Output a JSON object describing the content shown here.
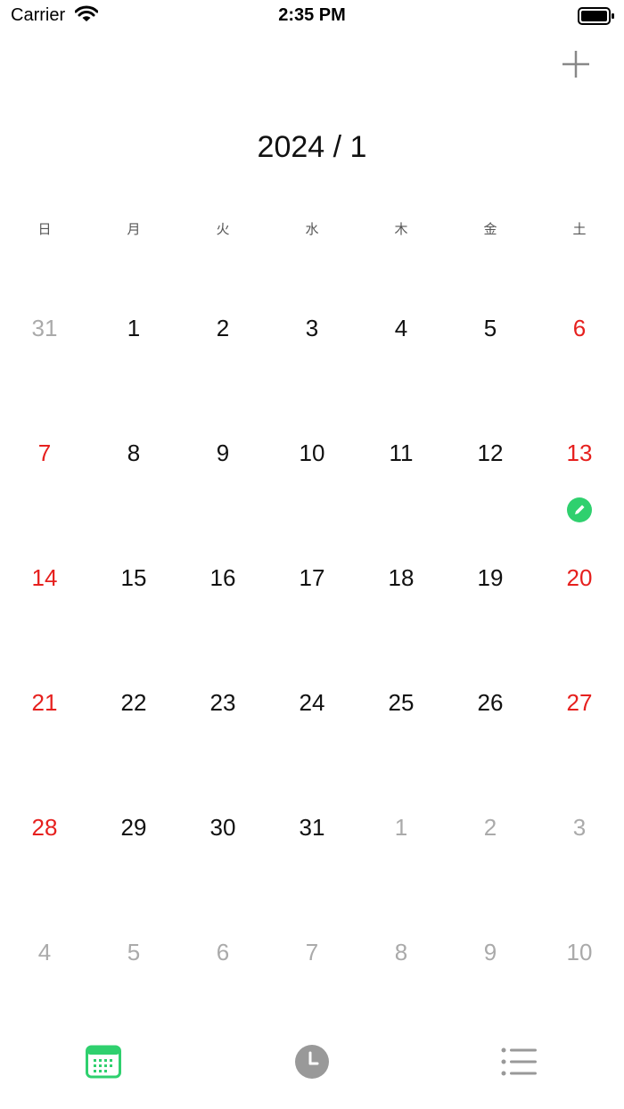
{
  "status_bar": {
    "carrier": "Carrier",
    "time": "2:35 PM"
  },
  "calendar": {
    "month_label": "2024 / 1",
    "weekdays": [
      "日",
      "月",
      "火",
      "水",
      "木",
      "金",
      "土"
    ],
    "weeks": [
      [
        {
          "label": "31",
          "outside": true,
          "weekend": false
        },
        {
          "label": "1",
          "outside": false,
          "weekend": false
        },
        {
          "label": "2",
          "outside": false,
          "weekend": false
        },
        {
          "label": "3",
          "outside": false,
          "weekend": false
        },
        {
          "label": "4",
          "outside": false,
          "weekend": false
        },
        {
          "label": "5",
          "outside": false,
          "weekend": false
        },
        {
          "label": "6",
          "outside": false,
          "weekend": true
        }
      ],
      [
        {
          "label": "7",
          "outside": false,
          "weekend": true
        },
        {
          "label": "8",
          "outside": false,
          "weekend": false
        },
        {
          "label": "9",
          "outside": false,
          "weekend": false
        },
        {
          "label": "10",
          "outside": false,
          "weekend": false
        },
        {
          "label": "11",
          "outside": false,
          "weekend": false
        },
        {
          "label": "12",
          "outside": false,
          "weekend": false
        },
        {
          "label": "13",
          "outside": false,
          "weekend": true,
          "has_event": true
        }
      ],
      [
        {
          "label": "14",
          "outside": false,
          "weekend": true
        },
        {
          "label": "15",
          "outside": false,
          "weekend": false
        },
        {
          "label": "16",
          "outside": false,
          "weekend": false
        },
        {
          "label": "17",
          "outside": false,
          "weekend": false
        },
        {
          "label": "18",
          "outside": false,
          "weekend": false
        },
        {
          "label": "19",
          "outside": false,
          "weekend": false
        },
        {
          "label": "20",
          "outside": false,
          "weekend": true
        }
      ],
      [
        {
          "label": "21",
          "outside": false,
          "weekend": true
        },
        {
          "label": "22",
          "outside": false,
          "weekend": false
        },
        {
          "label": "23",
          "outside": false,
          "weekend": false
        },
        {
          "label": "24",
          "outside": false,
          "weekend": false
        },
        {
          "label": "25",
          "outside": false,
          "weekend": false
        },
        {
          "label": "26",
          "outside": false,
          "weekend": false
        },
        {
          "label": "27",
          "outside": false,
          "weekend": true
        }
      ],
      [
        {
          "label": "28",
          "outside": false,
          "weekend": true
        },
        {
          "label": "29",
          "outside": false,
          "weekend": false
        },
        {
          "label": "30",
          "outside": false,
          "weekend": false
        },
        {
          "label": "31",
          "outside": false,
          "weekend": false
        },
        {
          "label": "1",
          "outside": true,
          "weekend": false
        },
        {
          "label": "2",
          "outside": true,
          "weekend": false
        },
        {
          "label": "3",
          "outside": true,
          "weekend": false
        }
      ],
      [
        {
          "label": "4",
          "outside": true,
          "weekend": false
        },
        {
          "label": "5",
          "outside": true,
          "weekend": false
        },
        {
          "label": "6",
          "outside": true,
          "weekend": false
        },
        {
          "label": "7",
          "outside": true,
          "weekend": false
        },
        {
          "label": "8",
          "outside": true,
          "weekend": false
        },
        {
          "label": "9",
          "outside": true,
          "weekend": false
        },
        {
          "label": "10",
          "outside": true,
          "weekend": false
        }
      ]
    ],
    "event_icon": "pencil-icon"
  },
  "tab_bar": {
    "tabs": [
      {
        "icon": "calendar-icon",
        "active": true
      },
      {
        "icon": "clock-icon",
        "active": false
      },
      {
        "icon": "list-icon",
        "active": false
      }
    ]
  },
  "colors": {
    "accent": "#2fd06e",
    "weekend": "#e6201e",
    "outside_day": "#aaaaaa",
    "inactive_icon": "#999999"
  }
}
